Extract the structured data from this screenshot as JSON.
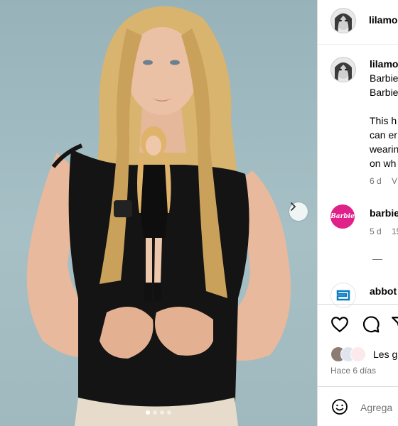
{
  "header": {
    "username": "lilamo"
  },
  "caption": {
    "username": "lilamo",
    "lines": [
      "Barbie",
      "Barbie",
      "This h",
      "can er",
      "wearin",
      "on wh"
    ],
    "time": "6 d",
    "extra": "V"
  },
  "comments": [
    {
      "username": "barbie",
      "avatar_text": "Barbie",
      "time": "5 d",
      "extra": "15"
    },
    {
      "username": "abbot",
      "sub": ""
    }
  ],
  "more_replies": "—",
  "likes": {
    "text": "Les g",
    "time": "Hace 6 días"
  },
  "comment_box": {
    "placeholder": "Agrega"
  },
  "carousel": {
    "slides": 4,
    "active": 0
  },
  "colors": {
    "barbie_pink": "#e0218a",
    "abbott_blue": "#0a7bc1",
    "photo_bg": "#a3bdc3"
  },
  "icons": [
    "heart-icon",
    "comment-icon",
    "share-icon",
    "emoji-icon",
    "chevron-right-icon"
  ]
}
